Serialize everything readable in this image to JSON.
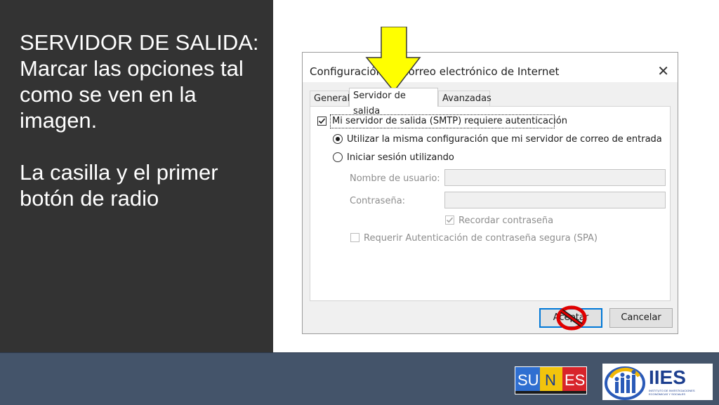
{
  "slide": {
    "title_line": "SERVIDOR DE SALIDA:",
    "instruction": "Marcar las opciones tal como se ven en la imagen.",
    "note": "La casilla y el primer botón de radio"
  },
  "dialog": {
    "title": "Configuración de correo electrónico de Internet",
    "close_glyph": "✕",
    "tabs": [
      "General",
      "Servidor de salida",
      "Avanzadas"
    ],
    "active_tab": "Servidor de salida",
    "smtp_auth_label": "Mi servidor de salida (SMTP) requiere autenticación",
    "smtp_auth_checked": true,
    "radio_same_label": "Utilizar la misma configuración que mi servidor de correo de entrada",
    "radio_same_selected": true,
    "radio_login_label": "Iniciar sesión utilizando",
    "radio_login_selected": false,
    "username_label": "Nombre de usuario:",
    "username_value": "",
    "password_label": "Contraseña:",
    "password_value": "",
    "remember_label": "Recordar contraseña",
    "remember_checked": true,
    "spa_label": "Requerir Autenticación de contraseña segura (SPA)",
    "spa_checked": false,
    "ok_label": "Aceptar",
    "cancel_label": "Cancelar"
  },
  "logos": {
    "sunes": "SU|N|ES",
    "iies": "IIES",
    "iies_subtitle": "INSTITUTO DE INVESTIGACIONES ECONÓMICAS Y SOCIALES"
  },
  "colors": {
    "panel": "#333333",
    "footer": "#44546a",
    "arrow": "#ffff00",
    "no_sign": "#e00000",
    "default_button_border": "#0078d7"
  },
  "icons": [
    "down-arrow-icon",
    "prohibited-icon",
    "close-icon",
    "checkmark-icon"
  ]
}
